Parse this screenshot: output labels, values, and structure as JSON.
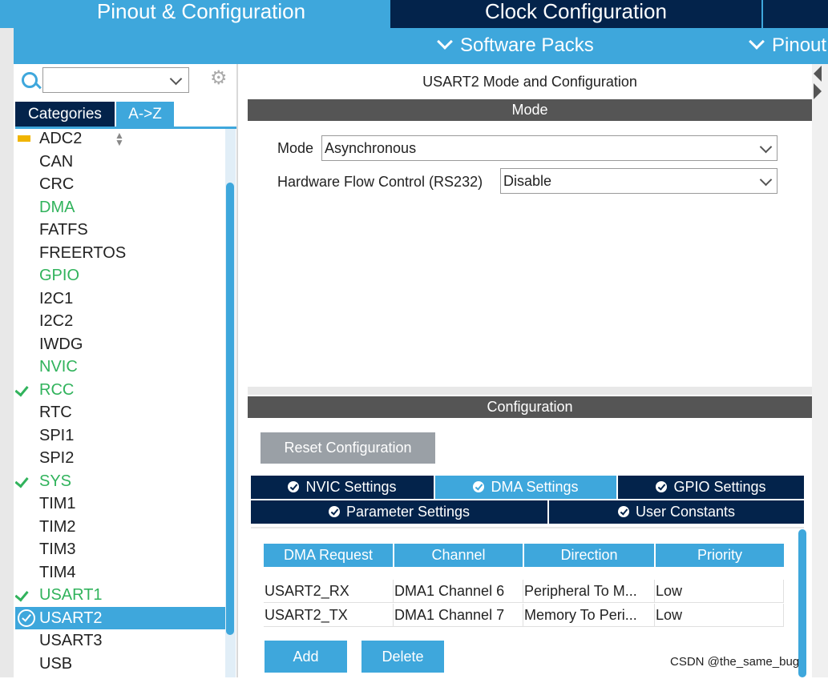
{
  "top_tabs": {
    "pinout": "Pinout & Configuration",
    "clock": "Clock Configuration"
  },
  "sub_menu": {
    "software_packs": "Software Packs",
    "pinout": "Pinout"
  },
  "sidebar": {
    "category_tabs": [
      "Categories",
      "A->Z"
    ],
    "items": [
      {
        "label": "ADC2",
        "state": "warning"
      },
      {
        "label": "CAN",
        "state": "normal"
      },
      {
        "label": "CRC",
        "state": "normal"
      },
      {
        "label": "DMA",
        "state": "green"
      },
      {
        "label": "FATFS",
        "state": "normal"
      },
      {
        "label": "FREERTOS",
        "state": "normal"
      },
      {
        "label": "GPIO",
        "state": "green"
      },
      {
        "label": "I2C1",
        "state": "normal"
      },
      {
        "label": "I2C2",
        "state": "normal"
      },
      {
        "label": "IWDG",
        "state": "normal"
      },
      {
        "label": "NVIC",
        "state": "green"
      },
      {
        "label": "RCC",
        "state": "checked"
      },
      {
        "label": "RTC",
        "state": "normal"
      },
      {
        "label": "SPI1",
        "state": "normal"
      },
      {
        "label": "SPI2",
        "state": "normal"
      },
      {
        "label": "SYS",
        "state": "checked"
      },
      {
        "label": "TIM1",
        "state": "normal"
      },
      {
        "label": "TIM2",
        "state": "normal"
      },
      {
        "label": "TIM3",
        "state": "normal"
      },
      {
        "label": "TIM4",
        "state": "normal"
      },
      {
        "label": "USART1",
        "state": "checked"
      },
      {
        "label": "USART2",
        "state": "selected"
      },
      {
        "label": "USART3",
        "state": "normal"
      },
      {
        "label": "USB",
        "state": "normal"
      }
    ]
  },
  "panel": {
    "title": "USART2 Mode and Configuration",
    "mode_header": "Mode",
    "mode_label": "Mode",
    "mode_value": "Asynchronous",
    "hfc_label": "Hardware Flow Control (RS232)",
    "hfc_value": "Disable",
    "config_header": "Configuration",
    "reset_button": "Reset Configuration",
    "tabs_row1": [
      "NVIC Settings",
      "DMA Settings",
      "GPIO Settings"
    ],
    "tabs_row2": [
      "Parameter Settings",
      "User Constants"
    ],
    "active_tab": "DMA Settings"
  },
  "dma_table": {
    "headers": [
      "DMA Request",
      "Channel",
      "Direction",
      "Priority"
    ],
    "rows": [
      [
        "USART2_RX",
        "DMA1 Channel 6",
        "Peripheral To M...",
        "Low"
      ],
      [
        "USART2_TX",
        "DMA1 Channel 7",
        "Memory To Peri...",
        "Low"
      ]
    ]
  },
  "buttons": {
    "add": "Add",
    "delete": "Delete"
  },
  "watermark": "CSDN @the_same_bug",
  "colors": {
    "accent": "#3ea7dc",
    "dark_navy": "#03234b",
    "green": "#31b35c",
    "section_gray": "#555555"
  }
}
